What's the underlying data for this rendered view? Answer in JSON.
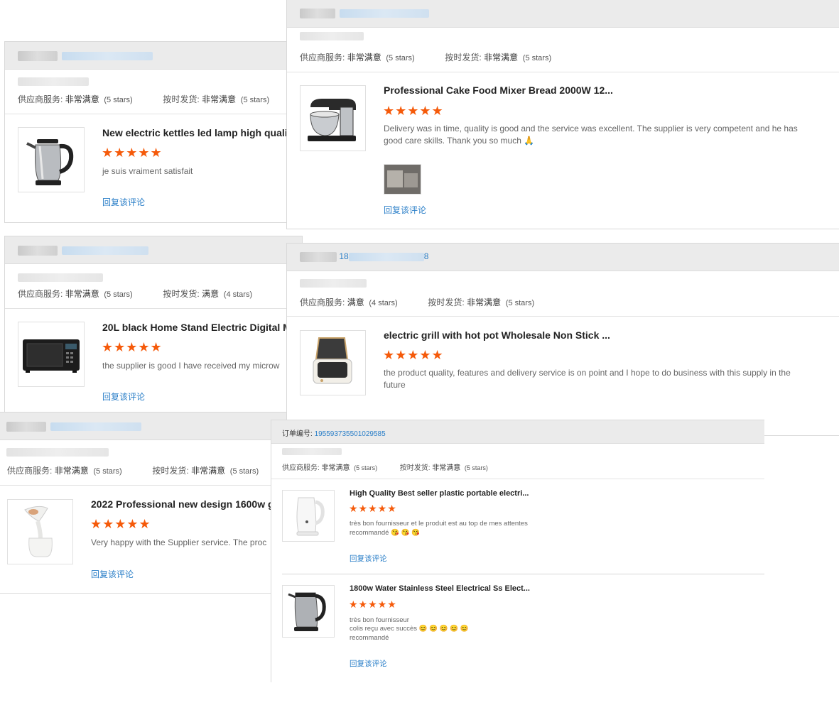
{
  "labels": {
    "supplier_service": "供应商服务:",
    "on_time": "按时发货:",
    "order_no": "订单编号:",
    "reply": "回复该评论"
  },
  "colors": {
    "star": "#f55a0a",
    "link": "#2b7fc8",
    "header_bg": "#ebebeb"
  },
  "reviews": [
    {
      "service_value": "非常满意",
      "service_stars": "(5 stars)",
      "ship_value": "非常满意",
      "ship_stars": "(5 stars)",
      "product_title": "New electric kettles led lamp high qualit",
      "rating": "★★★★★",
      "rating_value": 5,
      "review_text": "je suis vraiment satisfait",
      "product_icon": "kettle-icon"
    },
    {
      "service_value": "非常满意",
      "service_stars": "(5 stars)",
      "ship_value": "非常满意",
      "ship_stars": "(5 stars)",
      "product_title": "Professional Cake Food Mixer Bread 2000W 12...",
      "rating": "★★★★★",
      "rating_value": 5,
      "review_text": "Delivery was in time, quality is good and the service was excellent. The supplier is very competent and he has good care skills. Thank you so much 🙏",
      "product_icon": "stand-mixer-icon"
    },
    {
      "service_value": "非常满意",
      "service_stars": "(5 stars)",
      "ship_value": "满意",
      "ship_stars": "(4 stars)",
      "product_title": "20L black Home Stand Electric Digital M",
      "rating": "★★★★★",
      "rating_value": 5,
      "review_text": "the supplier is good I have received my microw",
      "product_icon": "microwave-icon"
    },
    {
      "order_partial": "18",
      "order_partial_2": "8",
      "service_value": "满意",
      "service_stars": "(4 stars)",
      "ship_value": "非常满意",
      "ship_stars": "(5 stars)",
      "product_title": "electric grill with hot pot Wholesale Non Stick ...",
      "rating": "★★★★★",
      "rating_value": 5,
      "review_text": "the product quality, features and delivery service is on point and I hope to do business with this supply in the future",
      "product_icon": "electric-grill-icon"
    },
    {
      "service_value": "非常满意",
      "service_stars": "(5 stars)",
      "ship_value": "非常满意",
      "ship_stars": "(5 stars)",
      "product_title": "2022 Professional new design 1600w g",
      "rating": "★★★★★",
      "rating_value": 5,
      "review_text": "Very happy with the Supplier service. The proc",
      "product_icon": "garment-steamer-icon"
    },
    {
      "order_number": "195593735501029585",
      "service_value": "非常满意",
      "service_stars": "(5 stars)",
      "ship_value": "非常满意",
      "ship_stars": "(5 stars)",
      "items": [
        {
          "product_title": "High Quality Best seller plastic portable electri...",
          "rating": "★★★★★",
          "rating_value": 5,
          "review_line1": "très bon fournisseur et le produit est au top de mes attentes",
          "review_line2": "recommandé 😘 😘 😘",
          "product_icon": "white-kettle-icon"
        },
        {
          "product_title": "1800w Water Stainless Steel Electrical Ss Elect...",
          "rating": "★★★★★",
          "rating_value": 5,
          "review_line1": "très bon fournisseur",
          "review_line2": "colis reçu avec succès 😊 😊 😊 😊 😊",
          "review_line3": "recommandé",
          "product_icon": "steel-kettle-icon"
        }
      ]
    }
  ]
}
